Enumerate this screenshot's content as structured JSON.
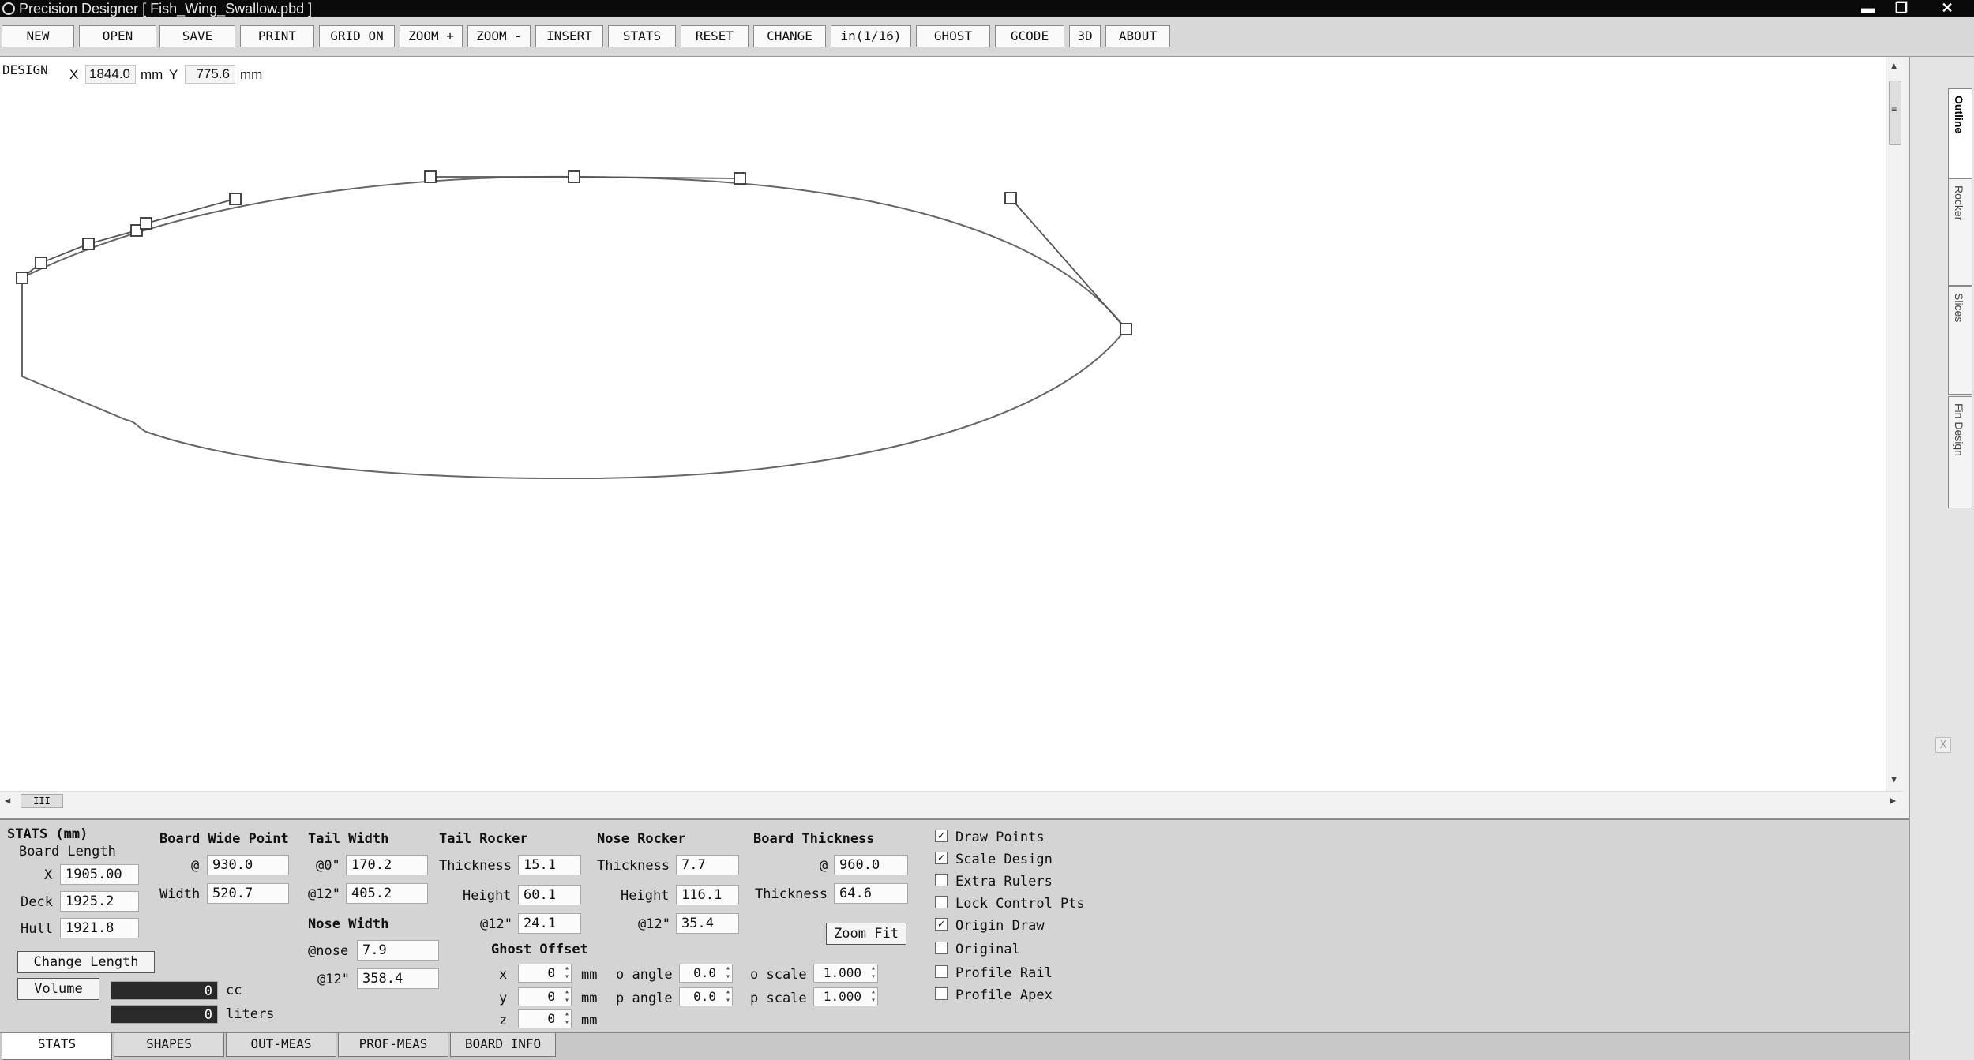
{
  "window": {
    "title": "Precision Designer [ Fish_Wing_Swallow.pbd ]",
    "minimize": "▬",
    "maximize": "❐",
    "close": "✕"
  },
  "toolbar": [
    {
      "id": "new",
      "label": "NEW"
    },
    {
      "id": "open",
      "label": "OPEN"
    },
    {
      "id": "save",
      "label": "SAVE"
    },
    {
      "id": "print",
      "label": "PRINT"
    },
    {
      "id": "grid",
      "label": "GRID ON"
    },
    {
      "id": "zoom-in",
      "label": "ZOOM +"
    },
    {
      "id": "zoom-out",
      "label": "ZOOM -"
    },
    {
      "id": "insert",
      "label": "INSERT"
    },
    {
      "id": "stats",
      "label": "STATS"
    },
    {
      "id": "reset",
      "label": "RESET"
    },
    {
      "id": "change",
      "label": "CHANGE"
    },
    {
      "id": "units",
      "label": "in(1/16)"
    },
    {
      "id": "ghost",
      "label": "GHOST"
    },
    {
      "id": "gcode",
      "label": "GCODE"
    },
    {
      "id": "3d",
      "label": "3D"
    },
    {
      "id": "about",
      "label": "ABOUT"
    }
  ],
  "design": {
    "label": "DESIGN",
    "x_label": "X",
    "x_value": "1844.0",
    "x_unit": "mm",
    "y_label": "Y",
    "y_value": "775.6",
    "y_unit": "mm"
  },
  "scroll": {
    "up": "▲",
    "down": "▼",
    "left": "◀",
    "right": "▶",
    "v_grip": "≡",
    "h_grip": "III"
  },
  "side_tabs": [
    "Outline",
    "Rocker",
    "Slices",
    "Fin Design"
  ],
  "side_close": "X",
  "stats": {
    "header": "STATS (mm)",
    "board_length": {
      "title": "Board Length",
      "x_label": "X",
      "x": "1905.00",
      "deck_label": "Deck",
      "deck": "1925.2",
      "hull_label": "Hull",
      "hull": "1921.8"
    },
    "change_length": "Change Length",
    "volume_button": "Volume",
    "volume_cc": "0",
    "volume_cc_unit": "cc",
    "volume_liters": "0",
    "volume_liters_unit": "liters",
    "wide_point": {
      "title": "Board Wide Point",
      "at_label": "@",
      "at": "930.0",
      "width_label": "Width",
      "width": "520.7"
    },
    "tail_width": {
      "title": "Tail Width",
      "at0_label": "@0\"",
      "at0": "170.2",
      "at12_label": "@12\"",
      "at12": "405.2"
    },
    "nose_width": {
      "title": "Nose Width",
      "at_nose_label": "@nose",
      "at_nose": "7.9",
      "at12_label": "@12\"",
      "at12": "358.4"
    },
    "tail_rocker": {
      "title": "Tail Rocker",
      "thickness_label": "Thickness",
      "thickness": "15.1",
      "height_label": "Height",
      "height": "60.1",
      "at12_label": "@12\"",
      "at12": "24.1"
    },
    "nose_rocker": {
      "title": "Nose Rocker",
      "thickness_label": "Thickness",
      "thickness": "7.7",
      "height_label": "Height",
      "height": "116.1",
      "at12_label": "@12\"",
      "at12": "35.4"
    },
    "board_thickness": {
      "title": "Board Thickness",
      "at_label": "@",
      "at": "960.0",
      "thickness_label": "Thickness",
      "thickness": "64.6"
    },
    "zoom_fit": "Zoom Fit",
    "ghost_offset": {
      "title": "Ghost Offset",
      "x_label": "x",
      "x": "0",
      "y_label": "y",
      "y": "0",
      "z_label": "z",
      "z": "0",
      "unit": "mm",
      "o_angle_label": "o angle",
      "o_angle": "0.0",
      "p_angle_label": "p angle",
      "p_angle": "0.0",
      "o_scale_label": "o scale",
      "o_scale": "1.000",
      "p_scale_label": "p scale",
      "p_scale": "1.000"
    },
    "checkboxes": [
      {
        "label": "Draw Points",
        "checked": true
      },
      {
        "label": "Scale Design",
        "checked": true
      },
      {
        "label": "Extra Rulers",
        "checked": false
      },
      {
        "label": "Lock Control Pts",
        "checked": false
      },
      {
        "label": "Origin Draw",
        "checked": true
      },
      {
        "label": "Original",
        "checked": false
      },
      {
        "label": "Profile Rail",
        "checked": false
      },
      {
        "label": "Profile Apex",
        "checked": false
      }
    ]
  },
  "bottom_tabs": [
    "STATS",
    "SHAPES",
    "OUT-MEAS",
    "PROF-MEAS",
    "BOARD INFO"
  ]
}
